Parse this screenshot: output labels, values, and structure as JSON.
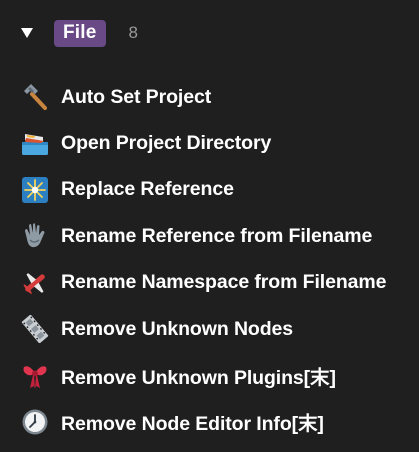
{
  "group": {
    "label": "File",
    "count": "8",
    "expanded": true,
    "badge_color": "#6a4a86"
  },
  "items": [
    {
      "label": "Auto Set Project",
      "icon": "hammer-icon"
    },
    {
      "label": "Open Project Directory",
      "icon": "drawer-icon"
    },
    {
      "label": "Replace Reference",
      "icon": "sparkle-icon"
    },
    {
      "label": "Rename Reference from Filename",
      "icon": "glove-icon"
    },
    {
      "label": "Rename Namespace from Filename",
      "icon": "airplane-icon"
    },
    {
      "label": "Remove Unknown Nodes",
      "icon": "film-strip-icon"
    },
    {
      "label": "Remove Unknown Plugins[末]",
      "icon": "ribbon-icon"
    },
    {
      "label": "Remove Node Editor Info[末]",
      "icon": "clock-icon"
    }
  ]
}
